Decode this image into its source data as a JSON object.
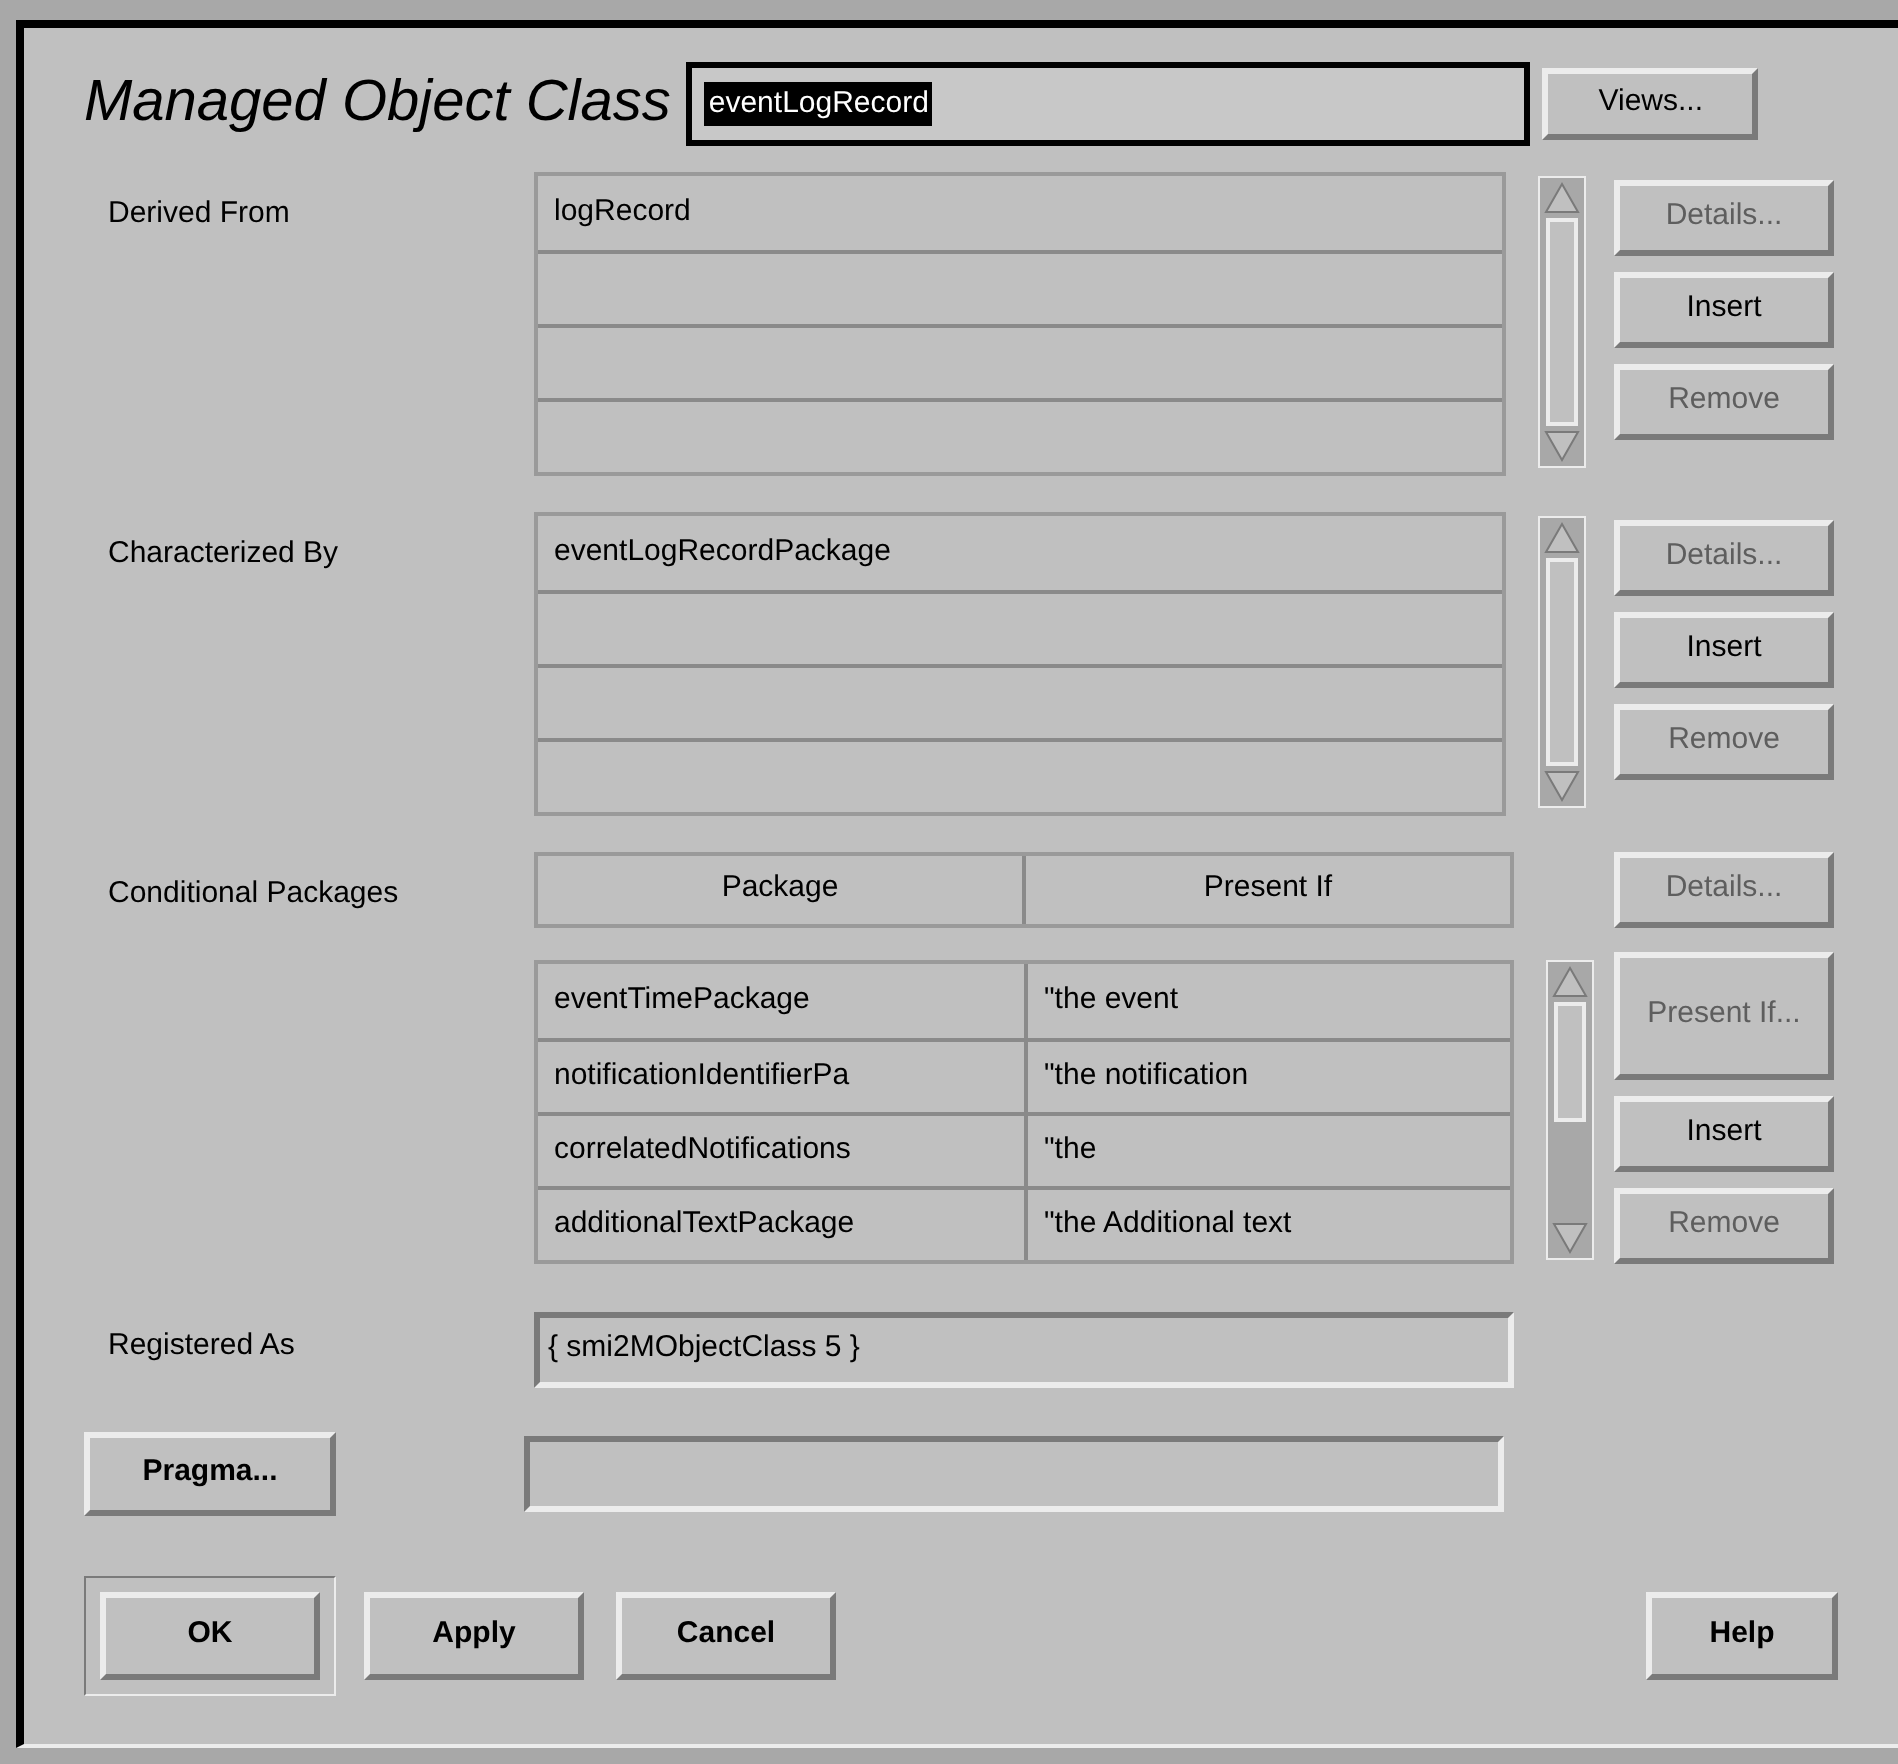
{
  "header": {
    "label": "Managed Object Class",
    "field": {
      "value": "eventLogRecord",
      "value_selected": true
    },
    "views_button": {
      "label": "Views...",
      "disabled": false
    }
  },
  "lists": [
    {
      "label": "Derived From",
      "rows": [
        "logRecord",
        "",
        "",
        ""
      ],
      "buttons": [
        {
          "label": "Details...",
          "disabled": true
        },
        {
          "label": "Insert",
          "disabled": false
        },
        {
          "label": "Remove",
          "disabled": true
        }
      ]
    },
    {
      "label": "Characterized By",
      "rows": [
        "eventLogRecordPackage",
        "",
        "",
        ""
      ],
      "buttons": [
        {
          "label": "Details...",
          "disabled": true
        },
        {
          "label": "Insert",
          "disabled": false
        },
        {
          "label": "Remove",
          "disabled": true
        }
      ]
    }
  ],
  "conditional": {
    "label": "Conditional Packages",
    "columns": [
      "Package",
      "Present If"
    ],
    "details_button": {
      "label": "Details...",
      "disabled": true
    },
    "rows": [
      [
        "eventTimePackage",
        "\"the event"
      ],
      [
        "notificationIdentifierPa",
        "\"the notification"
      ],
      [
        "correlatedNotifications",
        "\"the"
      ],
      [
        "additionalTextPackage",
        "\"the Additional text"
      ]
    ],
    "buttons": [
      {
        "label": "Present If...",
        "disabled": true
      },
      {
        "label": "Insert",
        "disabled": false
      },
      {
        "label": "Remove",
        "disabled": true
      }
    ]
  },
  "registered": {
    "label": "Registered As",
    "value": "{ smi2MObjectClass 5 }"
  },
  "pragma": {
    "button": {
      "label": "Pragma...",
      "disabled": false
    }
  },
  "footer": [
    {
      "label": "OK",
      "default": true
    },
    {
      "label": "Apply",
      "default": false
    },
    {
      "label": "Cancel",
      "default": false
    },
    {
      "label": "Help",
      "default": false
    }
  ]
}
